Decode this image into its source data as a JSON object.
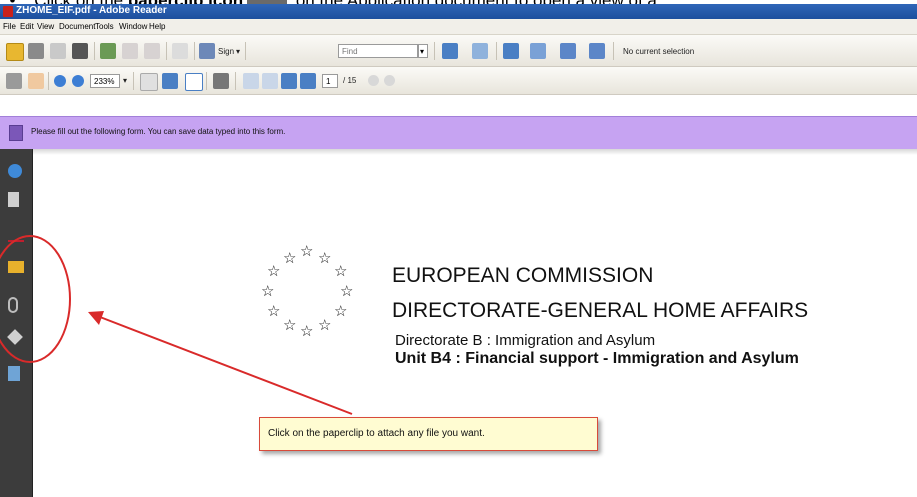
{
  "caption": {
    "pre": "Click on the ",
    "bold": "paperclip icon",
    "post": " on the Application document to open a view of a"
  },
  "window": {
    "title": "ZHOME_EIF.pdf - Adobe Reader"
  },
  "menu": [
    "File",
    "Edit",
    "View",
    "Document",
    "Tools",
    "Window",
    "Help"
  ],
  "toolbar1": {
    "sign_label": "Sign",
    "find_placeholder": "Find",
    "selection_status": "No current selection"
  },
  "toolbar2": {
    "zoom": "233%",
    "page_current": "1",
    "page_total": "/ 15"
  },
  "formbar": {
    "message": "Please fill out the following form. You can save data typed into this form."
  },
  "document": {
    "line1": "EUROPEAN COMMISSION",
    "line2": "DIRECTORATE-GENERAL HOME AFFAIRS",
    "line3": "Directorate B : Immigration and Asylum",
    "line4": "Unit B4 : Financial support - Immigration and Asylum"
  },
  "callout": {
    "text": "Click on the paperclip to attach any file you want."
  },
  "colors": {
    "formbar": "#c6a3f2",
    "leftnav": "#3c3c3c",
    "annotation": "#d92a2a",
    "callout_bg": "#fffcd2"
  }
}
